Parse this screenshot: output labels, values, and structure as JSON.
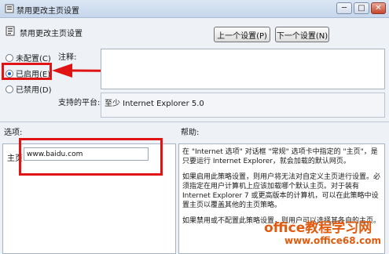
{
  "window": {
    "title": "禁用更改主页设置",
    "min": "─",
    "max": "□",
    "close": "✕"
  },
  "header": {
    "policy_name": "禁用更改主页设置",
    "prev_button": "上一个设置(P)",
    "next_button": "下一个设置(N)"
  },
  "state_options": [
    {
      "label": "未配置(C)",
      "selected": false
    },
    {
      "label": "已启用(E)",
      "selected": true
    },
    {
      "label": "已禁用(D)",
      "selected": false
    }
  ],
  "comment": {
    "label": "注释:",
    "value": ""
  },
  "platform": {
    "label": "支持的平台:",
    "value": "至少 Internet Explorer 5.0"
  },
  "options": {
    "label": "选项:",
    "homepage_label": "主页",
    "homepage_value": "www.baidu.com"
  },
  "help": {
    "label": "帮助:",
    "p1": "在 \"Internet 选项\" 对话框 \"常规\" 选项卡中指定的 \"主页\"，是只要运行 Internet Explorer，就会加载的默认网页。",
    "p2": "如果启用此策略设置，则用户将无法对自定义主页进行设置。必须指定在用户计算机上应该加载哪个默认主页。对于装有 Internet Explorer 7 或更高版本的计算机，可以在此策略中设置主页以覆盖其他的主页策略。",
    "p3": "如果禁用或不配置此策略设置，则用户可以选择其各自的主页。"
  },
  "watermark": {
    "line1": "office教程学习网",
    "line2": "www.office68.com"
  },
  "colors": {
    "annotation_red": "#e01414",
    "watermark": "#e15b0f"
  }
}
